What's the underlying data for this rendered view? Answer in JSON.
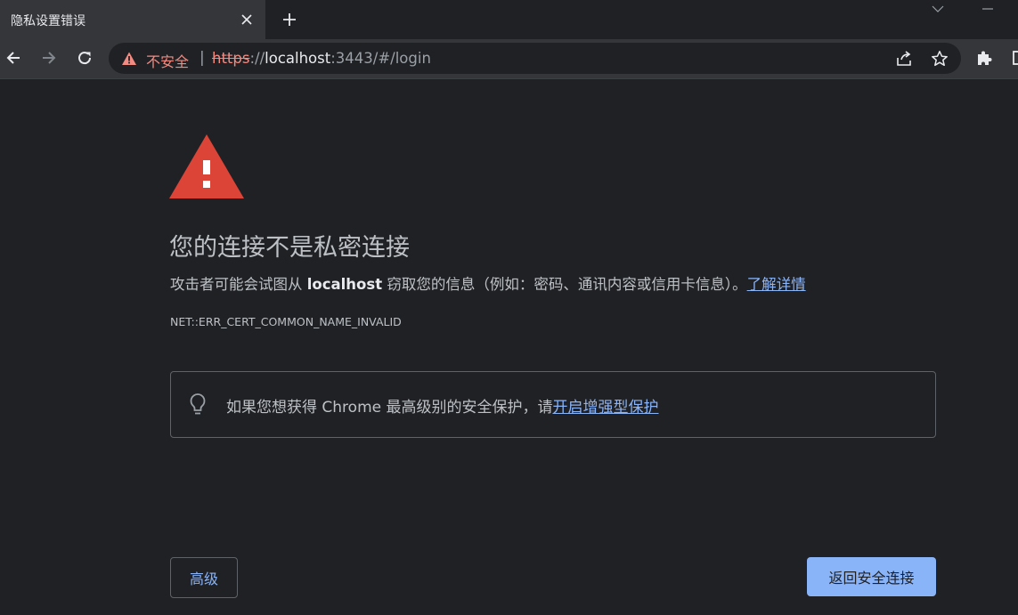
{
  "tab": {
    "title": "隐私设置错误"
  },
  "omnibox": {
    "security_label": "不安全",
    "separator": "|",
    "url_scheme": "https",
    "url_sep": "://",
    "url_host": "localhost",
    "url_rest": ":3443/#/login"
  },
  "interstitial": {
    "heading": "您的连接不是私密连接",
    "explanation_before": "攻击者可能会试图从 ",
    "explanation_host": "localhost",
    "explanation_after": " 窃取您的信息（例如：密码、通讯内容或信用卡信息）。",
    "learn_more": "了解详情",
    "error_code": "NET::ERR_CERT_COMMON_NAME_INVALID",
    "enhanced_text": "如果您想获得 Chrome 最高级别的安全保护，请",
    "enhanced_link": "开启增强型保护",
    "advanced_button": "高级",
    "back_button": "返回安全连接"
  },
  "colors": {
    "background": "#202124",
    "warning_red": "#db4437",
    "link_blue": "#8ab4f8",
    "insecure_red": "#f28b82"
  },
  "icons": [
    "close-icon",
    "plus-icon",
    "back-arrow-icon",
    "forward-arrow-icon",
    "reload-icon",
    "warning-icon",
    "share-icon",
    "star-icon",
    "extensions-icon",
    "side-panel-icon",
    "lightbulb-icon"
  ]
}
